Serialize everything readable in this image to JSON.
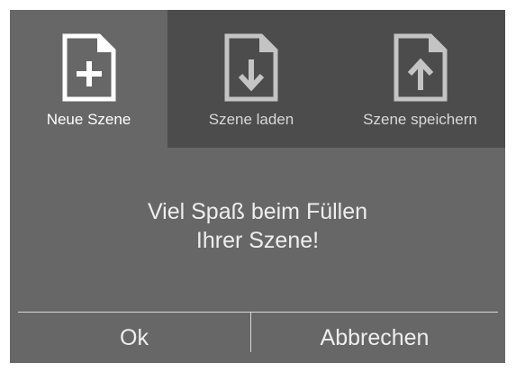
{
  "tabs": [
    {
      "label": "Neue Szene",
      "icon": "file-plus-icon",
      "active": true
    },
    {
      "label": "Szene laden",
      "icon": "file-download-icon",
      "active": false
    },
    {
      "label": "Szene speichern",
      "icon": "file-upload-icon",
      "active": false
    }
  ],
  "message": {
    "line1": "Viel Spaß beim Füllen",
    "line2": "Ihrer Szene!"
  },
  "footer": {
    "ok_label": "Ok",
    "cancel_label": "Abbrechen"
  },
  "colors": {
    "panel": "#676767",
    "tab_inactive": "#4c4c4c",
    "icon_active": "#ffffff",
    "icon_inactive": "#c4c4c4",
    "divider": "#d9d9d9"
  }
}
